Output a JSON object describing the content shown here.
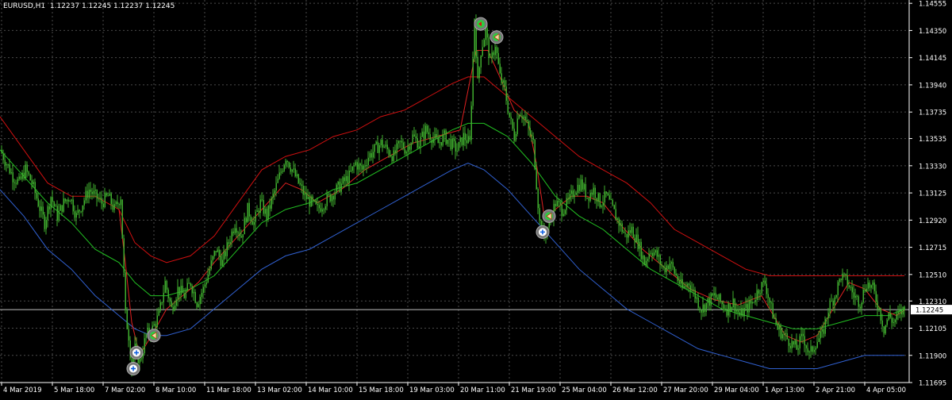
{
  "header": {
    "symbol": "EURUSD,H1",
    "open": "1.12237",
    "high": "1.12245",
    "low": "1.12237",
    "close": "1.12245"
  },
  "colors": {
    "background": "#000000",
    "grid": "#4a4a4a",
    "candle": "#3fae2e",
    "price_line": "#c0c0c0",
    "upper_band": "#d01010",
    "middle_band": "#22c022",
    "lower_band": "#3060d0",
    "fast_ma": "#e02020",
    "label_bg": "#ffffff"
  },
  "chart_data": {
    "type": "candlestick",
    "timeframe": "H1",
    "ylim": [
      1.11695,
      1.1458
    ],
    "current_price": 1.12245,
    "current_price_label": "1.12245",
    "ytick_values": [
      1.11695,
      1.119,
      1.12105,
      1.1231,
      1.1251,
      1.12715,
      1.1292,
      1.13125,
      1.1333,
      1.13535,
      1.13735,
      1.1394,
      1.14145,
      1.1435,
      1.14555
    ],
    "ytick_labels": [
      "1.11695",
      "1.11900",
      "1.12105",
      "1.12310",
      "1.12510",
      "1.12715",
      "1.12920",
      "1.13125",
      "1.13330",
      "1.13535",
      "1.13735",
      "1.13940",
      "1.14145",
      "1.14350",
      "1.14555"
    ],
    "xtick_labels": [
      "4 Mar 2019",
      "5 Mar 18:00",
      "7 Mar 02:00",
      "8 Mar 10:00",
      "11 Mar 18:00",
      "13 Mar 02:00",
      "14 Mar 10:00",
      "15 Mar 18:00",
      "19 Mar 03:00",
      "20 Mar 11:00",
      "21 Mar 19:00",
      "25 Mar 04:00",
      "26 Mar 12:00",
      "27 Mar 20:00",
      "29 Mar 04:00",
      "1 Apr 13:00",
      "2 Apr 21:00",
      "4 Apr 05:00"
    ],
    "price_path": [
      [
        0,
        1.1345
      ],
      [
        8,
        1.1335
      ],
      [
        16,
        1.1325
      ],
      [
        24,
        1.132
      ],
      [
        32,
        1.133
      ],
      [
        40,
        1.132
      ],
      [
        48,
        1.1305
      ],
      [
        56,
        1.129
      ],
      [
        64,
        1.131
      ],
      [
        72,
        1.1295
      ],
      [
        80,
        1.1305
      ],
      [
        88,
        1.131
      ],
      [
        96,
        1.1295
      ],
      [
        104,
        1.1305
      ],
      [
        112,
        1.1315
      ],
      [
        120,
        1.131
      ],
      [
        128,
        1.1305
      ],
      [
        136,
        1.131
      ],
      [
        144,
        1.13
      ],
      [
        152,
        1.131
      ],
      [
        158,
        1.122
      ],
      [
        162,
        1.1205
      ],
      [
        166,
        1.118
      ],
      [
        170,
        1.1195
      ],
      [
        176,
        1.1185
      ],
      [
        184,
        1.1205
      ],
      [
        192,
        1.121
      ],
      [
        200,
        1.122
      ],
      [
        208,
        1.1245
      ],
      [
        216,
        1.1225
      ],
      [
        224,
        1.124
      ],
      [
        232,
        1.1235
      ],
      [
        240,
        1.1245
      ],
      [
        248,
        1.123
      ],
      [
        256,
        1.124
      ],
      [
        264,
        1.1255
      ],
      [
        272,
        1.127
      ],
      [
        280,
        1.126
      ],
      [
        288,
        1.1275
      ],
      [
        296,
        1.129
      ],
      [
        304,
        1.128
      ],
      [
        312,
        1.13
      ],
      [
        320,
        1.129
      ],
      [
        328,
        1.1305
      ],
      [
        336,
        1.1295
      ],
      [
        344,
        1.131
      ],
      [
        352,
        1.1325
      ],
      [
        360,
        1.134
      ],
      [
        368,
        1.133
      ],
      [
        376,
        1.132
      ],
      [
        384,
        1.131
      ],
      [
        392,
        1.1305
      ],
      [
        400,
        1.13
      ],
      [
        408,
        1.1305
      ],
      [
        416,
        1.131
      ],
      [
        424,
        1.1315
      ],
      [
        432,
        1.132
      ],
      [
        440,
        1.1325
      ],
      [
        448,
        1.1335
      ],
      [
        456,
        1.133
      ],
      [
        464,
        1.134
      ],
      [
        472,
        1.1345
      ],
      [
        480,
        1.135
      ],
      [
        488,
        1.1345
      ],
      [
        496,
        1.134
      ],
      [
        504,
        1.135
      ],
      [
        512,
        1.1345
      ],
      [
        520,
        1.1355
      ],
      [
        528,
        1.135
      ],
      [
        536,
        1.136
      ],
      [
        544,
        1.1355
      ],
      [
        552,
        1.135
      ],
      [
        560,
        1.1355
      ],
      [
        568,
        1.135
      ],
      [
        576,
        1.1345
      ],
      [
        584,
        1.1355
      ],
      [
        592,
        1.135
      ],
      [
        598,
        1.1445
      ],
      [
        602,
        1.1395
      ],
      [
        606,
        1.142
      ],
      [
        612,
        1.1435
      ],
      [
        618,
        1.141
      ],
      [
        624,
        1.1425
      ],
      [
        630,
        1.14
      ],
      [
        636,
        1.139
      ],
      [
        642,
        1.137
      ],
      [
        648,
        1.1355
      ],
      [
        654,
        1.1375
      ],
      [
        660,
        1.137
      ],
      [
        666,
        1.136
      ],
      [
        672,
        1.135
      ],
      [
        676,
        1.132
      ],
      [
        680,
        1.129
      ],
      [
        686,
        1.128
      ],
      [
        692,
        1.129
      ],
      [
        700,
        1.1305
      ],
      [
        708,
        1.13
      ],
      [
        716,
        1.1305
      ],
      [
        724,
        1.1315
      ],
      [
        732,
        1.132
      ],
      [
        740,
        1.131
      ],
      [
        748,
        1.1315
      ],
      [
        756,
        1.1305
      ],
      [
        764,
        1.131
      ],
      [
        772,
        1.13
      ],
      [
        780,
        1.129
      ],
      [
        788,
        1.128
      ],
      [
        796,
        1.1285
      ],
      [
        804,
        1.1275
      ],
      [
        812,
        1.126
      ],
      [
        820,
        1.127
      ],
      [
        828,
        1.1265
      ],
      [
        836,
        1.1255
      ],
      [
        844,
        1.126
      ],
      [
        852,
        1.125
      ],
      [
        860,
        1.124
      ],
      [
        868,
        1.1245
      ],
      [
        876,
        1.1235
      ],
      [
        884,
        1.1225
      ],
      [
        892,
        1.123
      ],
      [
        900,
        1.1235
      ],
      [
        908,
        1.123
      ],
      [
        916,
        1.1225
      ],
      [
        924,
        1.123
      ],
      [
        932,
        1.122
      ],
      [
        940,
        1.1225
      ],
      [
        948,
        1.123
      ],
      [
        956,
        1.124
      ],
      [
        964,
        1.1245
      ],
      [
        972,
        1.1225
      ],
      [
        980,
        1.121
      ],
      [
        988,
        1.1205
      ],
      [
        996,
        1.12
      ],
      [
        1004,
        1.1195
      ],
      [
        1012,
        1.1205
      ],
      [
        1020,
        1.119
      ],
      [
        1028,
        1.12
      ],
      [
        1036,
        1.1205
      ],
      [
        1044,
        1.1225
      ],
      [
        1052,
        1.1235
      ],
      [
        1060,
        1.125
      ],
      [
        1068,
        1.1245
      ],
      [
        1076,
        1.1235
      ],
      [
        1084,
        1.123
      ],
      [
        1092,
        1.1245
      ],
      [
        1100,
        1.124
      ],
      [
        1108,
        1.1225
      ],
      [
        1114,
        1.121
      ],
      [
        1120,
        1.122
      ],
      [
        1126,
        1.1215
      ],
      [
        1132,
        1.122
      ],
      [
        1138,
        1.1224
      ]
    ],
    "upper_band": [
      [
        0,
        1.137
      ],
      [
        30,
        1.1345
      ],
      [
        60,
        1.132
      ],
      [
        90,
        1.131
      ],
      [
        120,
        1.131
      ],
      [
        150,
        1.13
      ],
      [
        170,
        1.1275
      ],
      [
        190,
        1.1265
      ],
      [
        210,
        1.126
      ],
      [
        240,
        1.1265
      ],
      [
        270,
        1.128
      ],
      [
        300,
        1.1305
      ],
      [
        330,
        1.133
      ],
      [
        360,
        1.134
      ],
      [
        390,
        1.1345
      ],
      [
        420,
        1.1355
      ],
      [
        450,
        1.136
      ],
      [
        480,
        1.137
      ],
      [
        510,
        1.1375
      ],
      [
        540,
        1.1385
      ],
      [
        570,
        1.1395
      ],
      [
        590,
        1.14
      ],
      [
        610,
        1.14
      ],
      [
        640,
        1.1385
      ],
      [
        670,
        1.137
      ],
      [
        700,
        1.1355
      ],
      [
        730,
        1.134
      ],
      [
        760,
        1.133
      ],
      [
        790,
        1.132
      ],
      [
        820,
        1.1305
      ],
      [
        850,
        1.1285
      ],
      [
        880,
        1.1275
      ],
      [
        910,
        1.1265
      ],
      [
        940,
        1.1255
      ],
      [
        970,
        1.125
      ],
      [
        1000,
        1.125
      ],
      [
        1030,
        1.125
      ],
      [
        1060,
        1.125
      ],
      [
        1090,
        1.125
      ],
      [
        1120,
        1.125
      ],
      [
        1140,
        1.125
      ]
    ],
    "middle_band": [
      [
        0,
        1.1345
      ],
      [
        30,
        1.1325
      ],
      [
        60,
        1.1305
      ],
      [
        90,
        1.129
      ],
      [
        120,
        1.127
      ],
      [
        150,
        1.126
      ],
      [
        170,
        1.1245
      ],
      [
        190,
        1.1235
      ],
      [
        210,
        1.1235
      ],
      [
        240,
        1.124
      ],
      [
        270,
        1.125
      ],
      [
        300,
        1.127
      ],
      [
        330,
        1.129
      ],
      [
        360,
        1.13
      ],
      [
        390,
        1.1305
      ],
      [
        420,
        1.1315
      ],
      [
        450,
        1.132
      ],
      [
        480,
        1.133
      ],
      [
        510,
        1.134
      ],
      [
        540,
        1.135
      ],
      [
        570,
        1.136
      ],
      [
        590,
        1.1365
      ],
      [
        610,
        1.1365
      ],
      [
        640,
        1.1355
      ],
      [
        670,
        1.1335
      ],
      [
        700,
        1.131
      ],
      [
        730,
        1.1295
      ],
      [
        760,
        1.1285
      ],
      [
        790,
        1.127
      ],
      [
        820,
        1.1255
      ],
      [
        850,
        1.1245
      ],
      [
        880,
        1.1235
      ],
      [
        910,
        1.1225
      ],
      [
        940,
        1.122
      ],
      [
        970,
        1.1215
      ],
      [
        1000,
        1.121
      ],
      [
        1030,
        1.121
      ],
      [
        1060,
        1.1215
      ],
      [
        1090,
        1.122
      ],
      [
        1120,
        1.122
      ],
      [
        1140,
        1.1225
      ]
    ],
    "lower_band": [
      [
        0,
        1.1315
      ],
      [
        30,
        1.1295
      ],
      [
        60,
        1.127
      ],
      [
        90,
        1.1255
      ],
      [
        120,
        1.1235
      ],
      [
        150,
        1.122
      ],
      [
        170,
        1.121
      ],
      [
        190,
        1.1205
      ],
      [
        210,
        1.1205
      ],
      [
        240,
        1.121
      ],
      [
        270,
        1.1225
      ],
      [
        300,
        1.124
      ],
      [
        330,
        1.1255
      ],
      [
        360,
        1.1265
      ],
      [
        390,
        1.127
      ],
      [
        420,
        1.128
      ],
      [
        450,
        1.129
      ],
      [
        480,
        1.13
      ],
      [
        510,
        1.131
      ],
      [
        540,
        1.132
      ],
      [
        570,
        1.133
      ],
      [
        590,
        1.1335
      ],
      [
        610,
        1.133
      ],
      [
        640,
        1.1315
      ],
      [
        670,
        1.1295
      ],
      [
        700,
        1.1275
      ],
      [
        730,
        1.1255
      ],
      [
        760,
        1.124
      ],
      [
        790,
        1.1225
      ],
      [
        820,
        1.1215
      ],
      [
        850,
        1.1205
      ],
      [
        880,
        1.1195
      ],
      [
        910,
        1.119
      ],
      [
        940,
        1.1185
      ],
      [
        970,
        1.118
      ],
      [
        1000,
        1.118
      ],
      [
        1030,
        1.118
      ],
      [
        1060,
        1.1185
      ],
      [
        1090,
        1.119
      ],
      [
        1120,
        1.119
      ],
      [
        1140,
        1.119
      ]
    ],
    "fast_ma": [
      [
        150,
        1.13
      ],
      [
        158,
        1.126
      ],
      [
        166,
        1.1215
      ],
      [
        176,
        1.119
      ],
      [
        186,
        1.12
      ],
      [
        196,
        1.121
      ],
      [
        210,
        1.1225
      ],
      [
        230,
        1.1235
      ],
      [
        250,
        1.1245
      ],
      [
        270,
        1.126
      ],
      [
        300,
        1.128
      ],
      [
        330,
        1.13
      ],
      [
        360,
        1.132
      ],
      [
        380,
        1.1315
      ],
      [
        400,
        1.1305
      ],
      [
        430,
        1.1315
      ],
      [
        460,
        1.133
      ],
      [
        490,
        1.134
      ],
      [
        520,
        1.135
      ],
      [
        550,
        1.1355
      ],
      [
        580,
        1.136
      ],
      [
        600,
        1.142
      ],
      [
        615,
        1.142
      ],
      [
        630,
        1.14
      ],
      [
        648,
        1.1375
      ],
      [
        666,
        1.1365
      ],
      [
        676,
        1.1335
      ],
      [
        686,
        1.1295
      ],
      [
        700,
        1.13
      ],
      [
        720,
        1.131
      ],
      [
        740,
        1.131
      ],
      [
        760,
        1.1305
      ],
      [
        780,
        1.129
      ],
      [
        810,
        1.127
      ],
      [
        840,
        1.1255
      ],
      [
        870,
        1.124
      ],
      [
        900,
        1.1232
      ],
      [
        930,
        1.1228
      ],
      [
        960,
        1.1235
      ],
      [
        975,
        1.122
      ],
      [
        990,
        1.1205
      ],
      [
        1010,
        1.12
      ],
      [
        1030,
        1.1205
      ],
      [
        1050,
        1.1225
      ],
      [
        1070,
        1.1245
      ],
      [
        1090,
        1.124
      ],
      [
        1110,
        1.1225
      ],
      [
        1130,
        1.122
      ],
      [
        1140,
        1.1224
      ]
    ],
    "markers": [
      {
        "kind": "sell-entry",
        "x": 606,
        "price": 1.144
      },
      {
        "kind": "sell-close",
        "x": 626,
        "price": 1.143
      },
      {
        "kind": "buy-entry",
        "x": 172,
        "price": 1.1192
      },
      {
        "kind": "buy-entry",
        "x": 168,
        "price": 1.118
      },
      {
        "kind": "buy-close",
        "x": 194,
        "price": 1.1205
      },
      {
        "kind": "buy-close",
        "x": 692,
        "price": 1.1295
      },
      {
        "kind": "buy-entry",
        "x": 684,
        "price": 1.1283
      }
    ]
  }
}
